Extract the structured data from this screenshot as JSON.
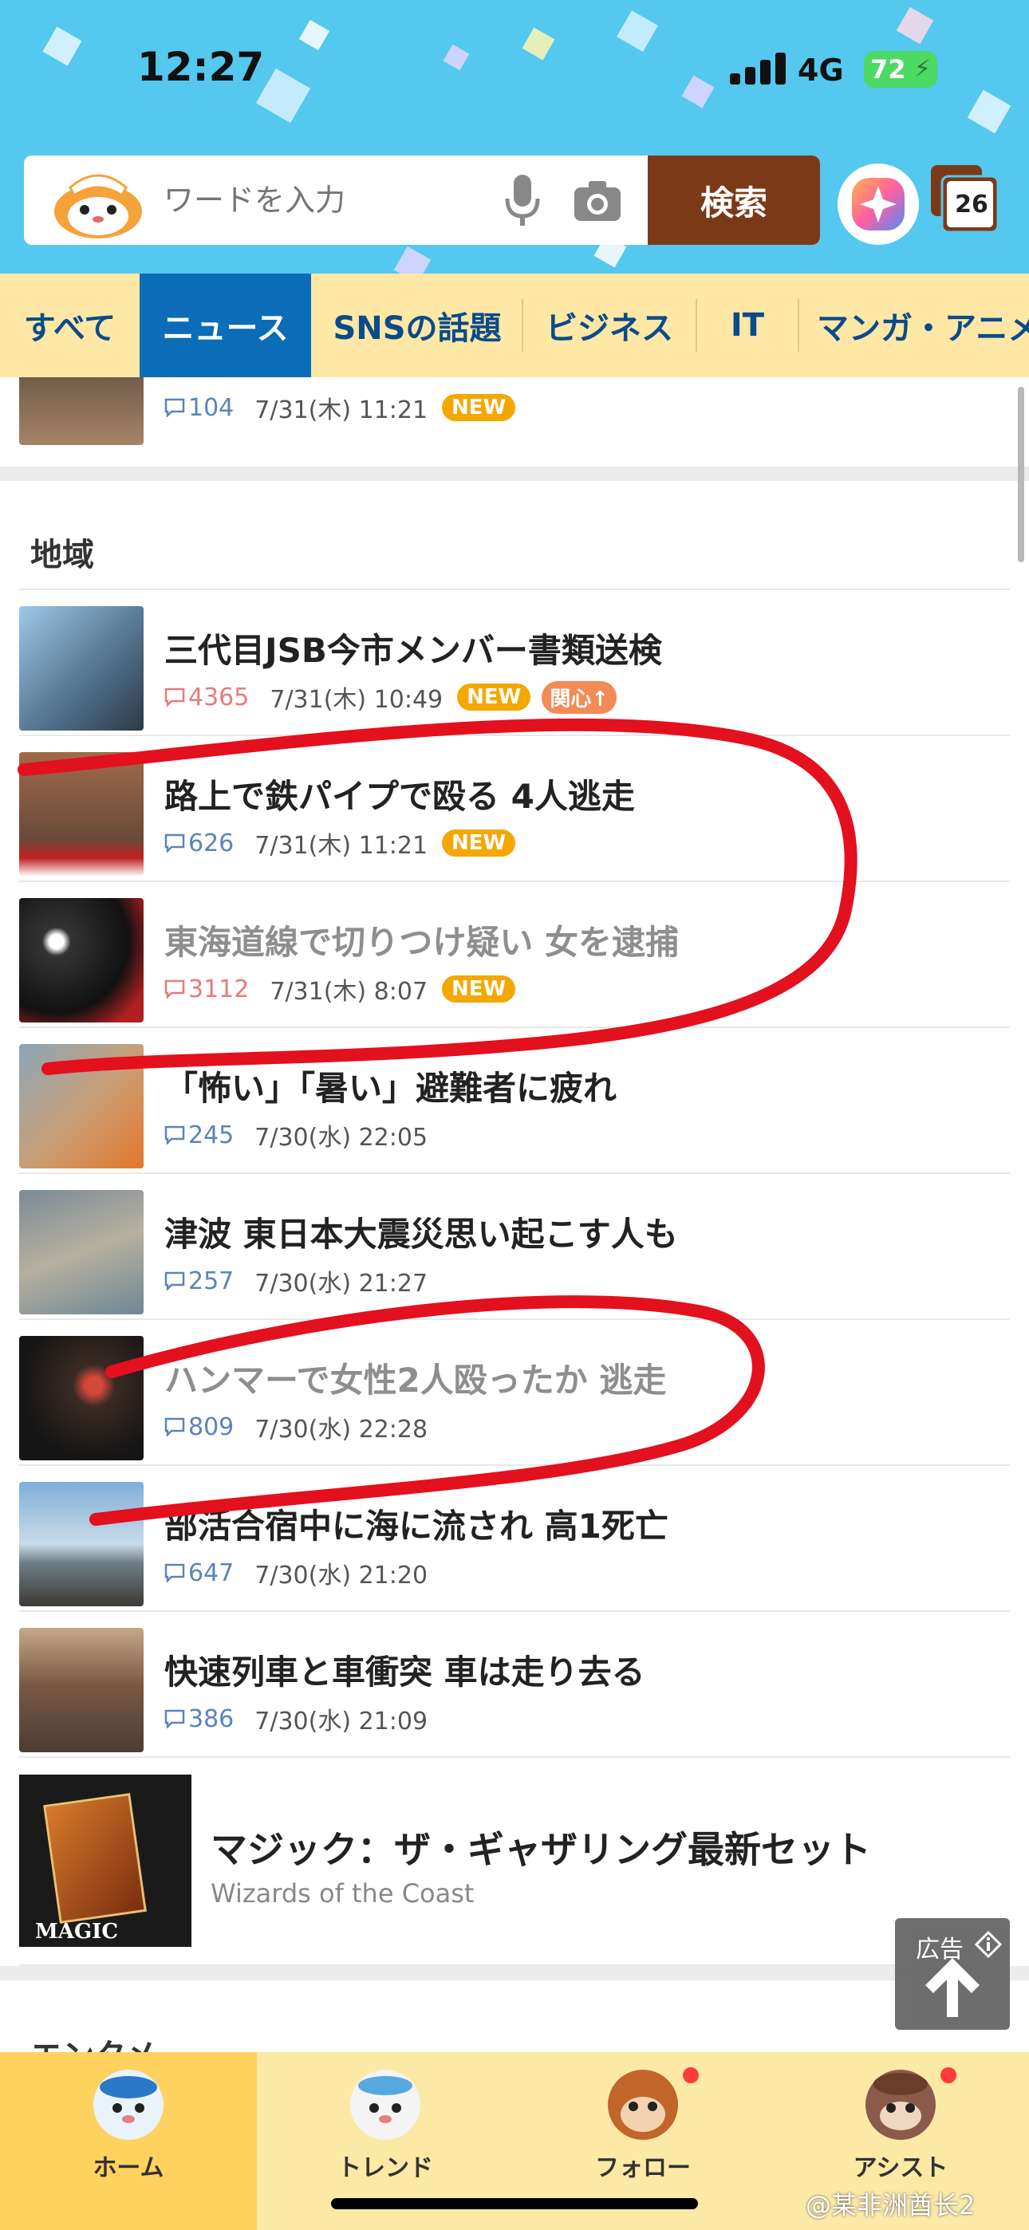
{
  "status_bar": {
    "time": "12:27",
    "network": "4G",
    "battery": "72"
  },
  "search": {
    "placeholder": "ワードを入力",
    "button_label": "検索",
    "tabs_count": "26"
  },
  "category_tabs": [
    "すべて",
    "ニュース",
    "SNSの話題",
    "ビジネス",
    "IT",
    "マンガ・アニメ"
  ],
  "active_tab": "ニュース",
  "top_partial_item": {
    "comments": "104",
    "date": "7/31(木) 11:21",
    "badge": "NEW"
  },
  "section_title": "地域",
  "news_items": [
    {
      "title": "三代目JSB今市メンバー書類送検",
      "comments": "4365",
      "date": "7/31(木) 10:49",
      "badge": "NEW",
      "badge2": "関心↑",
      "read": false,
      "hot": true
    },
    {
      "title": "路上で鉄パイプで殴る 4人逃走",
      "comments": "626",
      "date": "7/31(木) 11:21",
      "badge": "NEW",
      "read": false,
      "hot": false
    },
    {
      "title": "東海道線で切りつけ疑い 女を逮捕",
      "comments": "3112",
      "date": "7/31(木) 8:07",
      "badge": "NEW",
      "read": true,
      "hot": true
    },
    {
      "title": "「怖い」「暑い」避難者に疲れ",
      "comments": "245",
      "date": "7/30(水) 22:05",
      "read": false,
      "hot": false
    },
    {
      "title": "津波 東日本大震災思い起こす人も",
      "comments": "257",
      "date": "7/30(水) 21:27",
      "read": false,
      "hot": false
    },
    {
      "title": "ハンマーで女性2人殴ったか 逃走",
      "comments": "809",
      "date": "7/30(水) 22:28",
      "read": true,
      "hot": false
    },
    {
      "title": "部活合宿中に海に流され 高1死亡",
      "comments": "647",
      "date": "7/30(水) 21:20",
      "read": false,
      "hot": false
    },
    {
      "title": "快速列車と車衝突 車は走り去る",
      "comments": "386",
      "date": "7/30(水) 21:09",
      "read": false,
      "hot": false
    }
  ],
  "ad": {
    "title": "マジック：ザ・ギャザリング最新セット",
    "sponsor": "Wizards of the Coast",
    "label": "広告",
    "thumb_text": "MAGIC"
  },
  "next_section_partial": "エンタメ",
  "bottom_nav": [
    {
      "label": "ホーム",
      "active": true,
      "dot": false
    },
    {
      "label": "トレンド",
      "active": false,
      "dot": false
    },
    {
      "label": "フォロー",
      "active": false,
      "dot": true
    },
    {
      "label": "アシスト",
      "active": false,
      "dot": true
    }
  ],
  "watermark": "@某非洲酋长2",
  "colors": {
    "header_bg": "#54c8ee",
    "search_button": "#7b3a17",
    "tab_bar": "#ffe7a5",
    "tab_active": "#0b6cb8",
    "new_badge": "#f5a700",
    "annotation_red": "#e3101d"
  }
}
